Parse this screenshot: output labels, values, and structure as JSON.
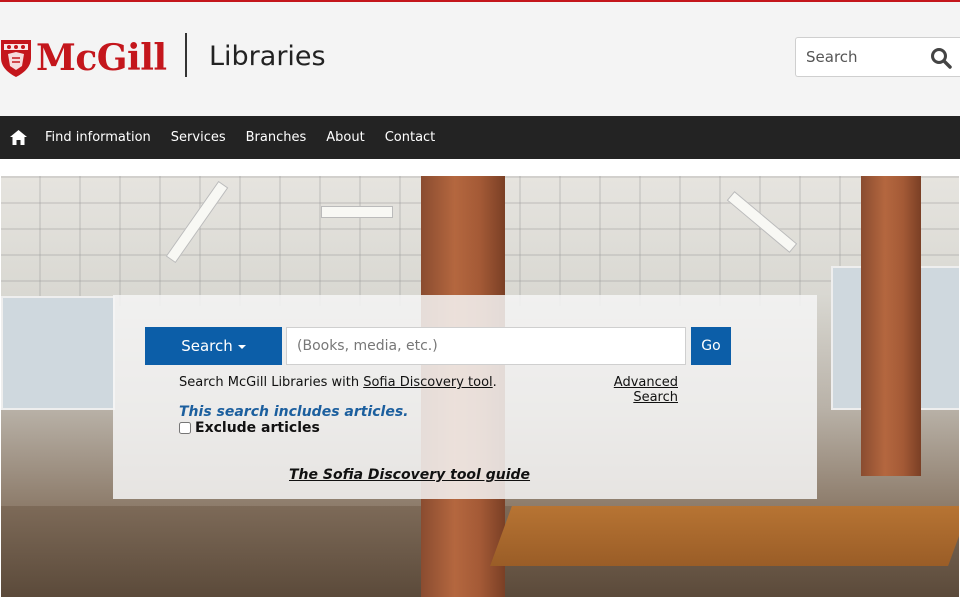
{
  "brand": {
    "logo_text": "McGill",
    "site_title": "Libraries",
    "accent": "#c4161c"
  },
  "header_search": {
    "placeholder": "Search",
    "icon": "search-icon"
  },
  "nav": {
    "home_icon": "home-icon",
    "items": [
      {
        "label": "Find information"
      },
      {
        "label": "Services"
      },
      {
        "label": "Branches"
      },
      {
        "label": "About"
      },
      {
        "label": "Contact"
      }
    ],
    "background": "#232323"
  },
  "search_panel": {
    "dropdown_label": "Search",
    "query_placeholder": "(Books, media, etc.)",
    "go_label": "Go",
    "help_prefix": "Search McGill Libraries with ",
    "help_link": "Sofia Discovery tool",
    "help_suffix": ".",
    "advanced_search": "Advanced Search",
    "includes_note": "This search includes articles.",
    "exclude_label": "Exclude articles",
    "guide_link": "The Sofia Discovery tool guide",
    "button_color": "#0c5ea8"
  }
}
